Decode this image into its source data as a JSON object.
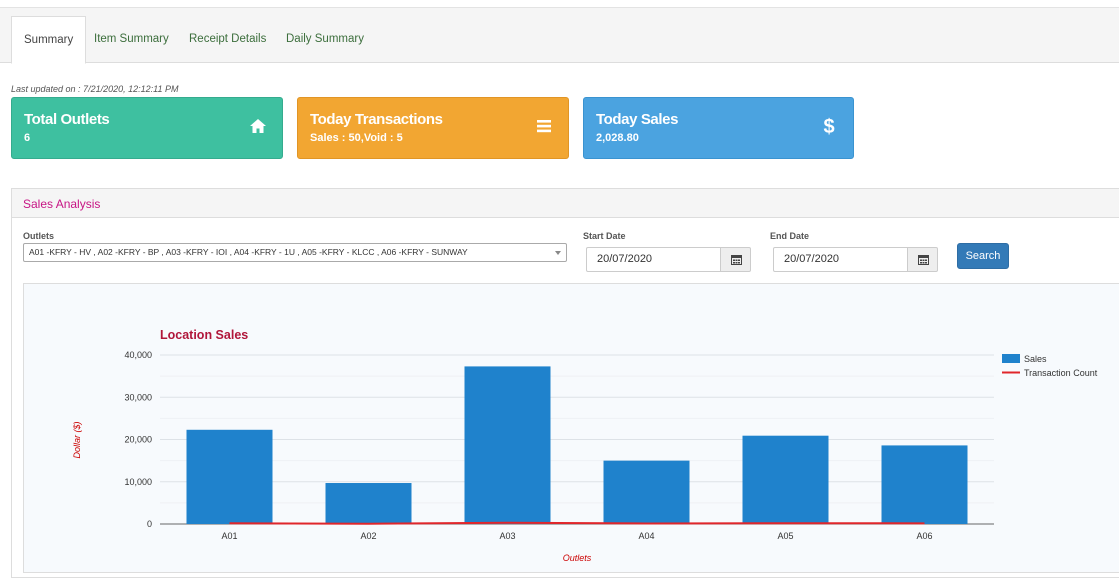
{
  "tabs": [
    {
      "label": "Summary",
      "active": true
    },
    {
      "label": "Item Summary",
      "active": false
    },
    {
      "label": "Receipt Details",
      "active": false
    },
    {
      "label": "Daily Summary",
      "active": false
    }
  ],
  "last_updated": "Last updated on : 7/21/2020, 12:12:11 PM",
  "cards": {
    "outlets": {
      "title": "Total Outlets",
      "value": "6",
      "icon": "home-icon",
      "color": "#3ec0a0"
    },
    "transactions": {
      "title": "Today Transactions",
      "value": "Sales : 50,Void : 5",
      "icon": "bars-icon",
      "color": "#f2a632"
    },
    "sales": {
      "title": "Today Sales",
      "value": "2,028.80",
      "icon": "dollar-icon",
      "color": "#4ba3e0"
    }
  },
  "panel": {
    "title": "Sales Analysis",
    "outlets_label": "Outlets",
    "outlets_value": "A01 -KFRY - HV , A02 -KFRY - BP , A03 -KFRY - IOI , A04 -KFRY - 1U , A05 -KFRY - KLCC , A06 -KFRY - SUNWAY",
    "start_label": "Start Date",
    "start_value": "20/07/2020",
    "end_label": "End Date",
    "end_value": "20/07/2020",
    "search_label": "Search"
  },
  "chart_data": {
    "type": "bar",
    "title": "Location Sales",
    "xlabel": "Outlets",
    "ylabel": "Dollar ($)",
    "categories": [
      "A01",
      "A02",
      "A03",
      "A04",
      "A05",
      "A06"
    ],
    "ylim": [
      0,
      40000
    ],
    "yticks": [
      0,
      10000,
      20000,
      30000,
      40000
    ],
    "ytick_labels": [
      "0",
      "10,000",
      "20,000",
      "30,000",
      "40,000"
    ],
    "series": [
      {
        "name": "Sales",
        "type": "bar",
        "color": "#1f82cc",
        "values": [
          22300,
          9700,
          37300,
          15000,
          20900,
          18600
        ]
      },
      {
        "name": "Transaction Count",
        "type": "line",
        "color": "#e0262b",
        "values": [
          180,
          60,
          300,
          120,
          180,
          160
        ]
      }
    ],
    "legend": "right",
    "grid": true
  }
}
